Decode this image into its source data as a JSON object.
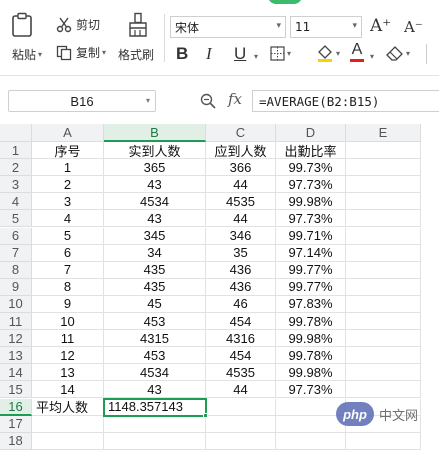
{
  "ribbon": {
    "paste_label": "粘贴",
    "cut_label": "剪切",
    "copy_label": "复制",
    "format_painter_label": "格式刷",
    "font_name": "宋体",
    "font_size": "11",
    "bold": "B",
    "italic": "I",
    "underline": "U",
    "font_color_glyph": "A",
    "increase_font_glyph": "A⁺",
    "decrease_font_glyph": "A⁻"
  },
  "formula_bar": {
    "cell_ref": "B16",
    "fx": "fx",
    "formula": "=AVERAGE(B2:B15)"
  },
  "columns": [
    "A",
    "B",
    "C",
    "D",
    "E"
  ],
  "rows": [
    {
      "num": "1",
      "a": "序号",
      "b": "实到人数",
      "c": "应到人数",
      "d": "出勤比率"
    },
    {
      "num": "2",
      "a": "1",
      "b": "365",
      "c": "366",
      "d": "99.73%"
    },
    {
      "num": "3",
      "a": "2",
      "b": "43",
      "c": "44",
      "d": "97.73%"
    },
    {
      "num": "4",
      "a": "3",
      "b": "4534",
      "c": "4535",
      "d": "99.98%"
    },
    {
      "num": "5",
      "a": "4",
      "b": "43",
      "c": "44",
      "d": "97.73%"
    },
    {
      "num": "6",
      "a": "5",
      "b": "345",
      "c": "346",
      "d": "99.71%"
    },
    {
      "num": "7",
      "a": "6",
      "b": "34",
      "c": "35",
      "d": "97.14%"
    },
    {
      "num": "8",
      "a": "7",
      "b": "435",
      "c": "436",
      "d": "99.77%"
    },
    {
      "num": "9",
      "a": "8",
      "b": "435",
      "c": "436",
      "d": "99.77%"
    },
    {
      "num": "10",
      "a": "9",
      "b": "45",
      "c": "46",
      "d": "97.83%"
    },
    {
      "num": "11",
      "a": "10",
      "b": "453",
      "c": "454",
      "d": "99.78%"
    },
    {
      "num": "12",
      "a": "11",
      "b": "4315",
      "c": "4316",
      "d": "99.98%"
    },
    {
      "num": "13",
      "a": "12",
      "b": "453",
      "c": "454",
      "d": "99.78%"
    },
    {
      "num": "14",
      "a": "13",
      "b": "4534",
      "c": "4535",
      "d": "99.98%"
    },
    {
      "num": "15",
      "a": "14",
      "b": "43",
      "c": "44",
      "d": "97.73%"
    },
    {
      "num": "16",
      "a": "平均人数",
      "b": "1148.357143",
      "c": "",
      "d": ""
    },
    {
      "num": "17",
      "a": "",
      "b": "",
      "c": "",
      "d": ""
    },
    {
      "num": "18",
      "a": "",
      "b": "",
      "c": "",
      "d": ""
    }
  ],
  "selected": {
    "row": "16",
    "col": "B"
  },
  "watermark": {
    "logo": "php",
    "text": "中文网"
  },
  "colors": {
    "accent": "#1d9c55",
    "header_bg": "#f1f2f4"
  }
}
